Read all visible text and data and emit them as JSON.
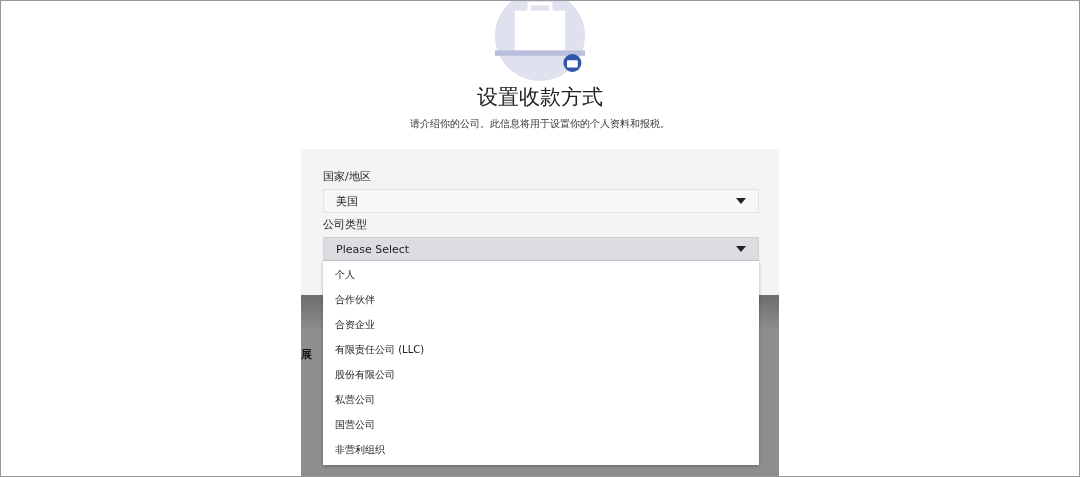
{
  "header": {
    "title": "设置收款方式",
    "subtitle": "请介绍你的公司。此信息将用于设置你的个人资料和报税。"
  },
  "fields": [
    {
      "label": "国家/地区",
      "value": "美国",
      "expanded": false
    },
    {
      "label": "公司类型",
      "value": "Please Select",
      "expanded": true,
      "options": [
        "个人",
        "合作伙伴",
        "合资企业",
        "有限责任公司 (LLC)",
        "股份有限公司",
        "私营公司",
        "国营公司",
        "非营利组织"
      ]
    }
  ],
  "background_text": "展"
}
